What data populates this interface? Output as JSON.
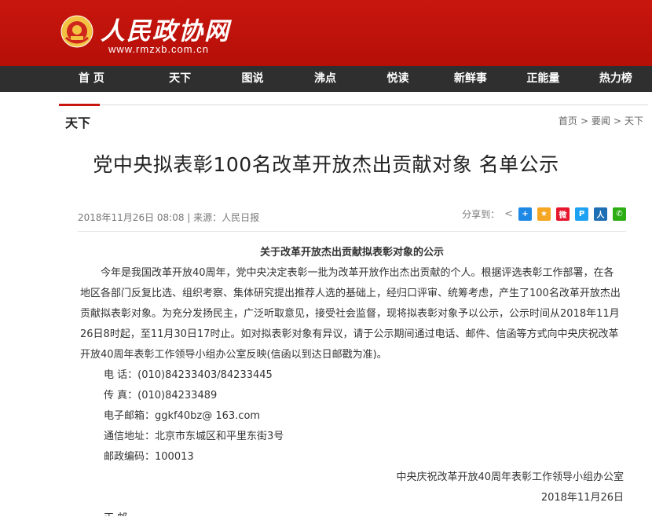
{
  "site": {
    "name": "人民政协网",
    "url": "www.rmzxb.com.cn"
  },
  "nav": [
    "首 页",
    "天下",
    "图说",
    "沸点",
    "悦读",
    "新鲜事",
    "正能量",
    "热力榜"
  ],
  "section": {
    "name": "天下",
    "breadcrumb": [
      "首页",
      "要闻",
      "天下"
    ],
    "separator": ">"
  },
  "article": {
    "headline": "党中央拟表彰100名改革开放杰出贡献对象 名单公示",
    "meta": "2018年11月26日 08:08 | 来源：人民日报",
    "share_label": "分享到：",
    "doc_title": "关于改革开放杰出贡献拟表彰对象的公示",
    "body": "今年是我国改革开放40周年，党中央决定表彰一批为改革开放作出杰出贡献的个人。根据评选表彰工作部署，在各地区各部门反复比选、组织考察、集体研究提出推荐人选的基础上，经归口评审、统筹考虑，产生了100名改革开放杰出贡献拟表彰对象。为充分发扬民主，广泛听取意见，接受社会监督，现将拟表彰对象予以公示，公示时间从2018年11月26日8时起，至11月30日17时止。如对拟表彰对象有异议，请于公示期间通过电话、邮件、信函等方式向中央庆祝改革开放40周年表彰工作领导小组办公室反映(信函以到达日邮戳为准)。",
    "contacts": [
      "电 话：(010)84233403/84233445",
      "传 真：(010)84233489",
      "电子邮箱：ggkf40bz@ 163.com",
      "通信地址：北京市东城区和平里东街3号",
      "邮政编码：100013"
    ],
    "signature_org": "中央庆祝改革开放40周年表彰工作领导小组办公室",
    "signature_date": "2018年11月26日",
    "next_line": "正 邮"
  },
  "colors": {
    "brand_red": "#c8160e",
    "nav_dark": "#2f2f2f"
  },
  "share_icons": [
    {
      "name": "share-more-icon",
      "glyph": "+",
      "color": "#1e88e5"
    },
    {
      "name": "qzone-icon",
      "glyph": "★",
      "color": "#f5a623"
    },
    {
      "name": "weibo-icon",
      "glyph": "微",
      "color": "#e6162d"
    },
    {
      "name": "tencent-weibo-icon",
      "glyph": "P",
      "color": "#1da1f2"
    },
    {
      "name": "renren-icon",
      "glyph": "人",
      "color": "#1f6fb5"
    },
    {
      "name": "wechat-icon",
      "glyph": "✆",
      "color": "#2bad13"
    }
  ]
}
